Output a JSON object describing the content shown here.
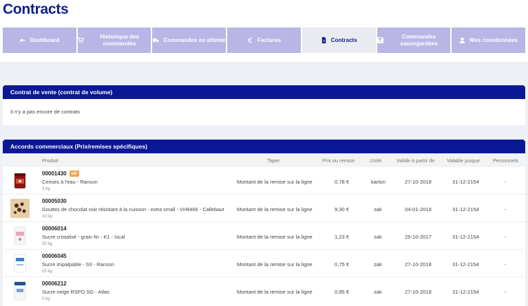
{
  "page": {
    "title": "Contracts"
  },
  "tabs": [
    {
      "label": "Dashboard",
      "icon": "dashboard-icon"
    },
    {
      "label": "Historique des commandes",
      "icon": "cart-icon"
    },
    {
      "label": "Commandes en attente",
      "icon": "truck-icon"
    },
    {
      "label": "Factures",
      "icon": "euro-icon"
    },
    {
      "label": "Contracts",
      "icon": "document-icon",
      "active": true
    },
    {
      "label": "Commandes sauvegardées",
      "icon": "save-icon"
    },
    {
      "label": "Mes coordonnées",
      "icon": "user-icon"
    }
  ],
  "contract_panel": {
    "title": "Contrat de vente (contrat de volume)",
    "empty_message": "Il n'y a pas encore de contrats"
  },
  "accords_panel": {
    "title": "Accords commerciaux (Prix/remises spécifiques)",
    "columns": {
      "produit": "Produit",
      "taper": "Taper",
      "prix": "Prix ou remise",
      "unite": "Unité",
      "valide": "Valide à partir de",
      "valable": "Valable jusque",
      "personnels": "Personnels"
    },
    "rows": [
      {
        "code": "00001430",
        "badge": "ob",
        "name": "Cerises à l'eau - Ranson",
        "weight": "3 kg",
        "type": "Montant de la remise sur la ligne",
        "price": "0,78 €",
        "unit": "karton",
        "from": "27-10-2018",
        "until": "31-12-2154",
        "personal": "-"
      },
      {
        "code": "00005030",
        "badge": "",
        "name": "Gouttes de chocolat noir résistant à la cuisson - extra small - VH9466 - Callebaut",
        "weight": "10 kg",
        "type": "Montant de la remise sur la ligne",
        "price": "9,30 €",
        "unit": "zak",
        "from": "04-01-2018",
        "until": "31-12-2154",
        "personal": "-"
      },
      {
        "code": "00006014",
        "badge": "",
        "name": "Sucre cristalisé - grain fin - K1 - Iscal",
        "weight": "25 kg",
        "type": "Montant de la remise sur la ligne",
        "price": "1,23 €",
        "unit": "zak",
        "from": "25-10-2017",
        "until": "31-12-2154",
        "personal": "-"
      },
      {
        "code": "00006045",
        "badge": "",
        "name": "Sucre impalpable - S0 - Ranson",
        "weight": "25 kg",
        "type": "Montant de la remise sur la ligne",
        "price": "0,75 €",
        "unit": "zak",
        "from": "27-10-2018",
        "until": "31-12-2154",
        "personal": "-"
      },
      {
        "code": "00006212",
        "badge": "",
        "name": "Sucre neige RSPO SG - Atlas",
        "weight": "5 kg",
        "type": "Montant de la remise sur la ligne",
        "price": "0,95 €",
        "unit": "zak",
        "from": "27-10-2018",
        "until": "31-12-2154",
        "personal": "-"
      }
    ]
  },
  "colors": {
    "primary": "#0a1895",
    "tab": "#b9b6e6",
    "tab_active": "#e9ebf1",
    "badge": "#f2a54d"
  }
}
